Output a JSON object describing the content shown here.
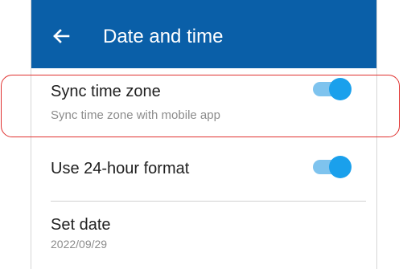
{
  "appbar": {
    "title": "Date and time",
    "back_icon": "arrow-left-icon",
    "color": "#0a5fa8"
  },
  "settings": [
    {
      "title": "Sync time zone",
      "subtitle": "Sync time zone with mobile app",
      "enabled": true
    },
    {
      "title": "Use 24-hour format",
      "enabled": true
    },
    {
      "title": "Set date",
      "value": "2022/09/29"
    }
  ],
  "colors": {
    "toggle_thumb": "#1aa0ec",
    "toggle_track": "#7ec3ee",
    "highlight": "#e0312f"
  }
}
